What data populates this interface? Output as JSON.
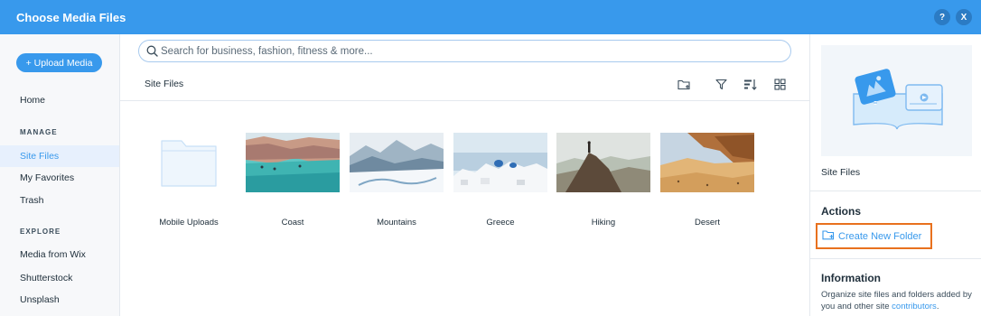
{
  "header": {
    "title": "Choose Media Files",
    "help": "?",
    "close": "X"
  },
  "sidebar": {
    "upload_label": "+ Upload Media",
    "home": "Home",
    "manage_title": "MANAGE",
    "manage_items": [
      "Site Files",
      "My Favorites",
      "Trash"
    ],
    "explore_title": "EXPLORE",
    "explore_items": [
      "Media from Wix",
      "Shutterstock",
      "Unsplash"
    ]
  },
  "search": {
    "placeholder": "Search for business, fashion, fitness & more..."
  },
  "breadcrumb": "Site Files",
  "toolbar": {
    "icons": [
      "new-folder-icon",
      "filter-icon",
      "sort-icon",
      "grid-view-icon"
    ]
  },
  "items": [
    {
      "name": "Mobile Uploads",
      "type": "folder"
    },
    {
      "name": "Coast",
      "type": "image"
    },
    {
      "name": "Mountains",
      "type": "image"
    },
    {
      "name": "Greece",
      "type": "image"
    },
    {
      "name": "Hiking",
      "type": "image"
    },
    {
      "name": "Desert",
      "type": "image"
    }
  ],
  "right_panel": {
    "selection_title": "Site Files",
    "actions_title": "Actions",
    "create_folder_label": "Create New Folder",
    "info_title": "Information",
    "info_text": "Organize site files and folders added by you and other site ",
    "info_link": "contributors",
    "info_end": "."
  },
  "colors": {
    "accent": "#3899ec",
    "highlight_border": "#e8711e",
    "active_bg": "#e7f0fd"
  }
}
